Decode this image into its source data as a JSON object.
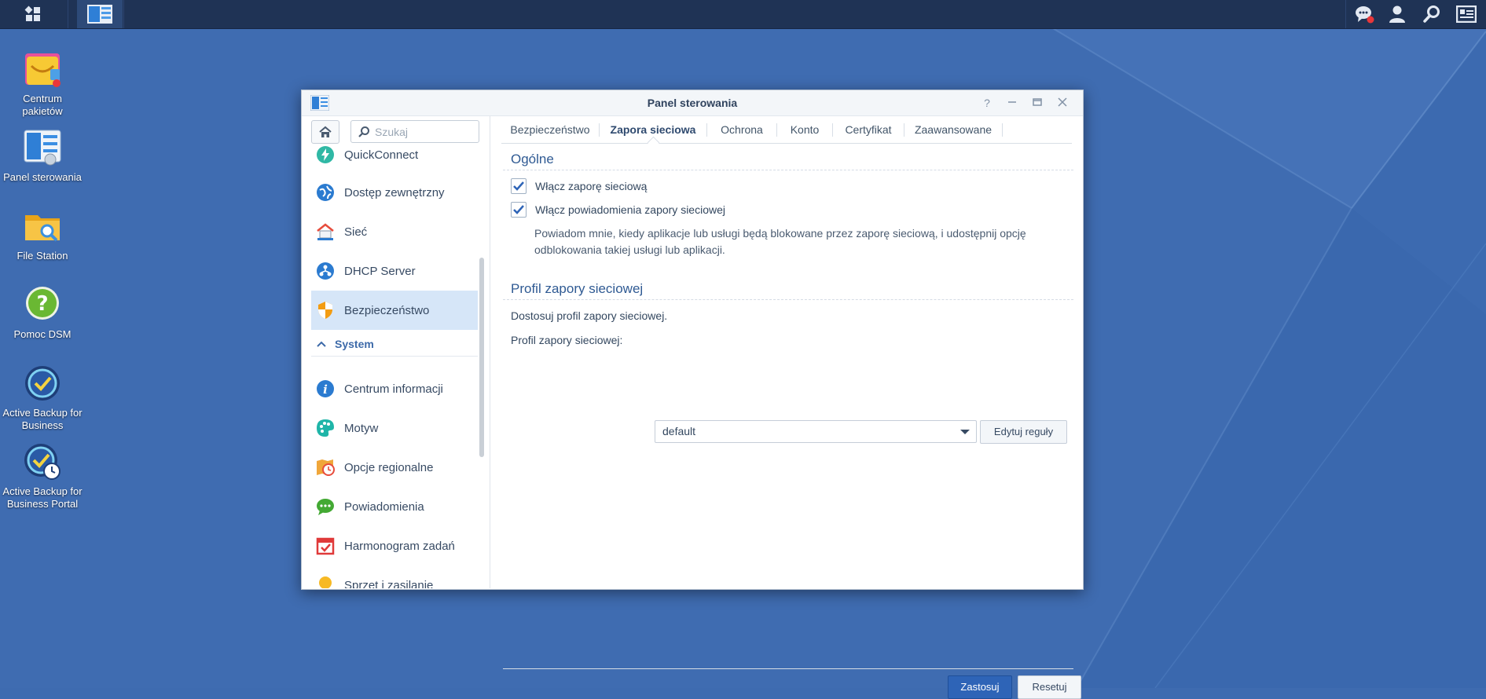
{
  "colors": {
    "desktop_bg": "#3e6bb0",
    "taskbar_bg": "#1f3355",
    "accent": "#2e64b7",
    "active_nav": "#d6e6f8"
  },
  "taskbar": {
    "left_icons": [
      "main-menu-icon",
      "control-panel-icon"
    ],
    "right_icons": [
      "notifications-icon",
      "user-icon",
      "search-icon",
      "widgets-icon"
    ]
  },
  "desktop": {
    "icons": [
      {
        "line1": "Centrum",
        "line2": "pakietów",
        "icon": "package-center-icon"
      },
      {
        "line1": "Panel sterowania",
        "line2": "",
        "icon": "control-panel-icon"
      },
      {
        "line1": "File Station",
        "line2": "",
        "icon": "file-station-icon"
      },
      {
        "line1": "Pomoc DSM",
        "line2": "",
        "icon": "help-icon"
      },
      {
        "line1": "Active Backup for",
        "line2": "Business",
        "icon": "active-backup-icon"
      },
      {
        "line1": "Active Backup for",
        "line2": "Business Portal",
        "icon": "active-backup-portal-icon"
      }
    ]
  },
  "window": {
    "title": "Panel sterowania",
    "controls": [
      "help-icon",
      "minimize-icon",
      "maximize-icon",
      "close-icon"
    ]
  },
  "sidebar": {
    "search_placeholder": "Szukaj",
    "items": [
      {
        "label": "QuickConnect",
        "icon": "quickconnect-icon"
      },
      {
        "label": "Dostęp zewnętrzny",
        "icon": "external-access-icon"
      },
      {
        "label": "Sieć",
        "icon": "network-icon"
      },
      {
        "label": "DHCP Server",
        "icon": "dhcp-icon"
      },
      {
        "label": "Bezpieczeństwo",
        "icon": "security-icon",
        "active": true
      },
      {
        "label": "Centrum informacji",
        "icon": "info-center-icon"
      },
      {
        "label": "Motyw",
        "icon": "theme-icon"
      },
      {
        "label": "Opcje regionalne",
        "icon": "regional-options-icon"
      },
      {
        "label": "Powiadomienia",
        "icon": "notification-icon"
      },
      {
        "label": "Harmonogram zadań",
        "icon": "task-scheduler-icon"
      },
      {
        "label": "Sprzęt i zasilanie",
        "icon": "hardware-power-icon"
      }
    ],
    "group_system": "System"
  },
  "tabs": [
    "Bezpieczeństwo",
    "Zapora sieciowa",
    "Ochrona",
    "Konto",
    "Certyfikat",
    "Zaawansowane"
  ],
  "active_tab": "Zapora sieciowa",
  "general": {
    "title": "Ogólne",
    "enable_firewall": {
      "label": "Włącz zaporę sieciową",
      "checked": true
    },
    "enable_notifications": {
      "label": "Włącz powiadomienia zapory sieciowej",
      "checked": true
    },
    "description_line1": "Powiadom mnie, kiedy aplikacje lub usługi będą blokowane przez zaporę sieciową, i udostępnij opcję",
    "description_line2": "odblokowania takiej usługi lub aplikacji."
  },
  "profile": {
    "title": "Profil zapory sieciowej",
    "hint": "Dostosuj profil zapory sieciowej.",
    "field_label": "Profil zapory sieciowej:",
    "selected": "default",
    "edit_button": "Edytuj reguły"
  },
  "footer": {
    "apply": "Zastosuj",
    "reset": "Resetuj"
  }
}
